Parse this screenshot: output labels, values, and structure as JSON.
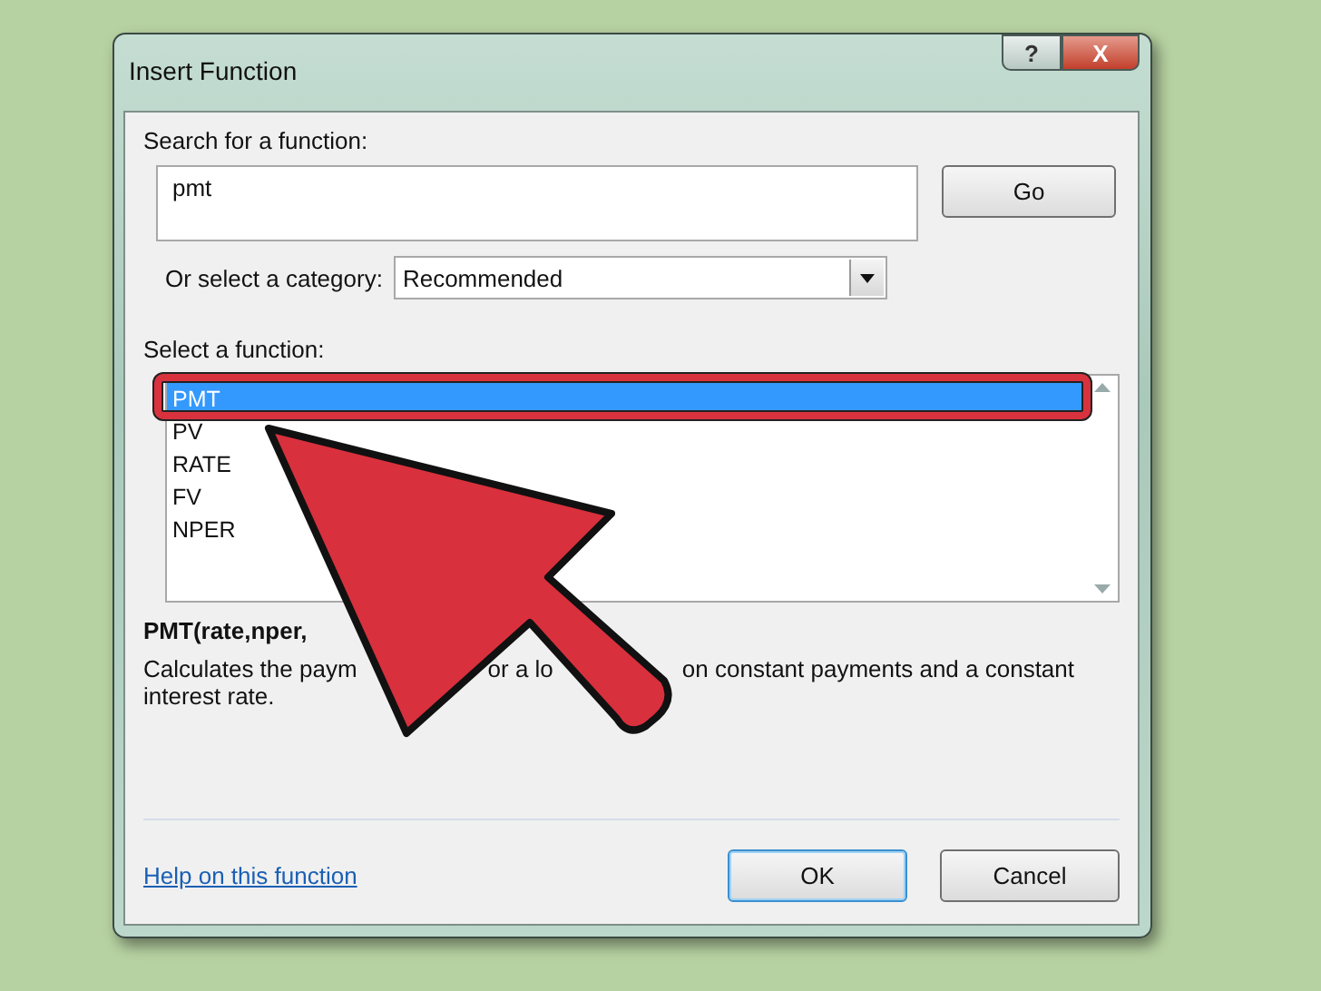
{
  "window": {
    "title": "Insert Function",
    "title_buttons": [
      {
        "kind": "help",
        "label": "?"
      },
      {
        "kind": "close",
        "label": "X"
      }
    ]
  },
  "search": {
    "label": "Search for a function:",
    "value": "pmt",
    "button": "Go"
  },
  "category": {
    "label": "Or select a category:",
    "value": "Recommended"
  },
  "functions": {
    "label": "Select a function:",
    "items": [
      {
        "name": "PMT",
        "selected": true
      },
      {
        "name": "PV",
        "selected": false
      },
      {
        "name": "RATE",
        "selected": false
      },
      {
        "name": "FV",
        "selected": false
      },
      {
        "name": "NPER",
        "selected": false
      }
    ]
  },
  "signature": "PMT(rate,nper,",
  "description": {
    "line_1": [
      "Calculates the paym",
      "or a lo",
      "on constant payments and a constant"
    ],
    "line_2": "interest rate."
  },
  "help_link": "Help on this function",
  "buttons": [
    {
      "label": "OK",
      "default": true
    },
    {
      "label": "Cancel",
      "default": false
    }
  ]
}
